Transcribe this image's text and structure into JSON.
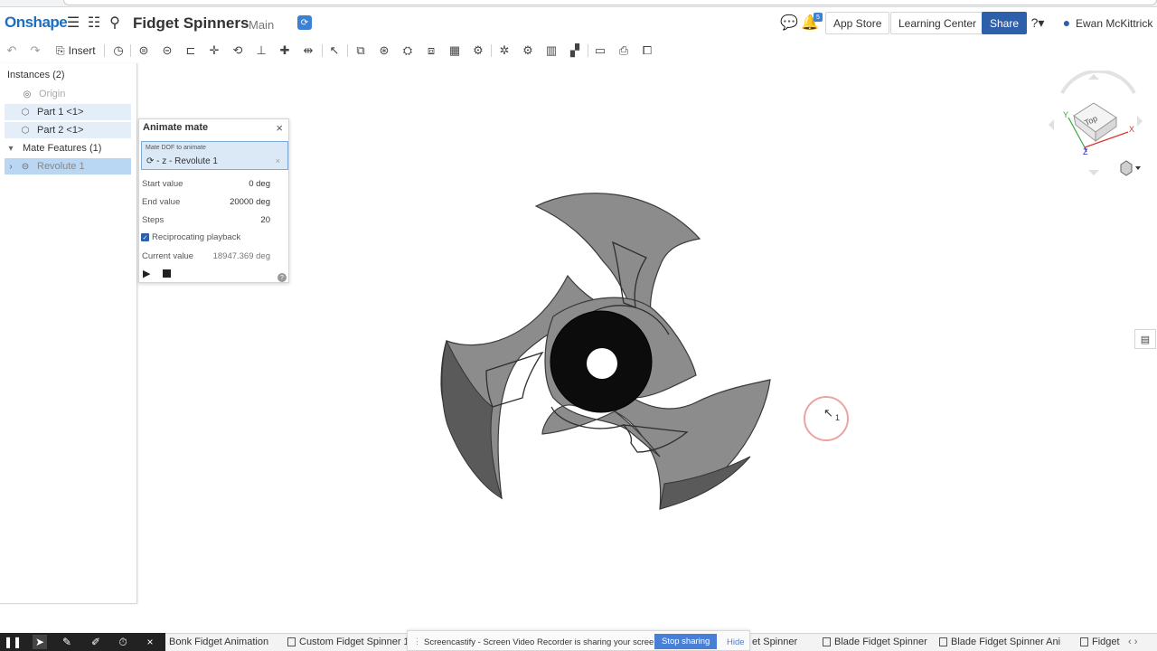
{
  "app": {
    "logo": "Onshape",
    "document_title": "Fidget Spinners",
    "branch": "Main"
  },
  "header": {
    "app_store": "App Store",
    "learning_center": "Learning Center",
    "share": "Share",
    "notification_count": "5",
    "user_name": "Ewan McKittrick"
  },
  "toolbar": {
    "insert_label": "Insert"
  },
  "instances_panel": {
    "title": "Instances (2)",
    "origin": "Origin",
    "parts": [
      "Part 1 <1>",
      "Part 2 <1>"
    ],
    "mate_features": "Mate Features (1)",
    "revolute": "Revolute 1"
  },
  "animate_mate": {
    "title": "Animate mate",
    "dof_label": "Mate DOF to animate",
    "dof_value": "- z - Revolute 1",
    "start_label": "Start value",
    "start_value": "0 deg",
    "end_label": "End value",
    "end_value": "20000 deg",
    "steps_label": "Steps",
    "steps_value": "20",
    "reciprocating_label": "Reciprocating playback",
    "reciprocating_checked": true,
    "current_label": "Current value",
    "current_value": "18947.369 deg"
  },
  "viewcube": {
    "face_label": "Top",
    "axis_x": "X",
    "axis_y": "Y",
    "axis_z": "Z"
  },
  "screencast": {
    "message": "Screencastify - Screen Video Recorder is sharing your screen.",
    "stop": "Stop sharing",
    "hide": "Hide"
  },
  "bottom_tabs": [
    "Bonk Fidget Animation",
    "Custom Fidget Spinner 1",
    "et Spinner",
    "Blade Fidget Spinner",
    "Blade Fidget Spinner Ani",
    "Fidget"
  ],
  "cursor_label": "1",
  "colors": {
    "brand": "#1a6fc4",
    "share": "#2d5faa",
    "selection": "#b9d6f2",
    "spinner_body": "#8a8a8a",
    "spinner_hub": "#111111"
  }
}
